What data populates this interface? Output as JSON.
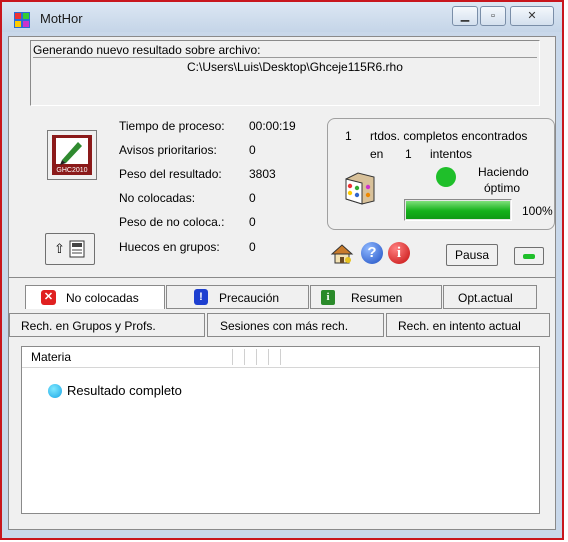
{
  "window": {
    "title": "MotHor"
  },
  "file_box": {
    "line1": "Generando nuevo resultado sobre archivo:",
    "line2": "C:\\Users\\Luis\\Desktop\\Ghceje115R6.rho"
  },
  "stats": {
    "labels": [
      "Tiempo de proceso:",
      "Avisos prioritarios:",
      "Peso del resultado:",
      "No colocadas:",
      "Peso de no coloca.:",
      "Huecos en grupos:"
    ],
    "values": [
      "00:00:19",
      "0",
      "3803",
      "0",
      "0",
      "0"
    ]
  },
  "logo": {
    "text": "GHC2010"
  },
  "result_box": {
    "count": "1",
    "text1": "rtdos. completos encontrados",
    "en": "en",
    "attempts": "1",
    "text2": "intentos",
    "status1": "Haciendo",
    "status2": "óptimo",
    "progress": 100,
    "progress_label": "100%"
  },
  "pause_label": "Pausa",
  "tabs": {
    "row1": [
      "No colocadas",
      "Precaución",
      "Resumen",
      "Opt.actual"
    ],
    "row2": [
      "Rech. en Grupos y Profs.",
      "Sesiones con más rech.",
      "Rech. en intento actual"
    ]
  },
  "list": {
    "header": "Materia",
    "items": [
      "Resultado completo"
    ]
  },
  "colors": {
    "accent_green": "#1fbf2a",
    "window_border": "#c8161d"
  }
}
